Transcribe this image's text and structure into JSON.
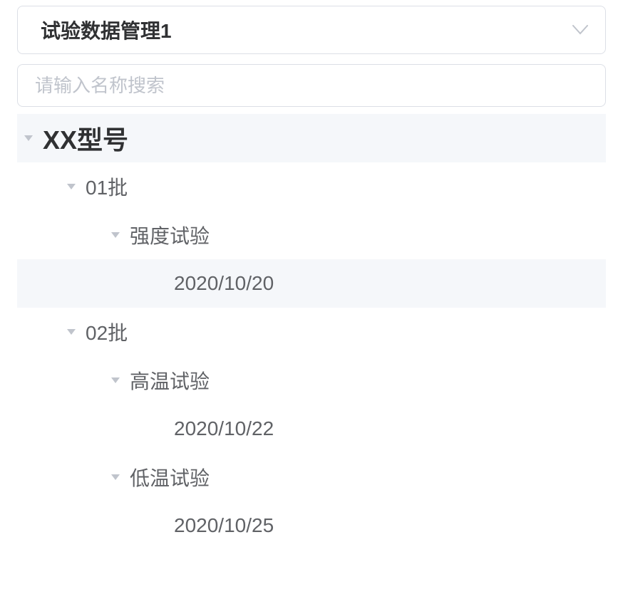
{
  "select": {
    "value": "试验数据管理1"
  },
  "search": {
    "placeholder": "请输入名称搜索"
  },
  "tree": {
    "root": {
      "label": "XX型号",
      "children": [
        {
          "label": "01批",
          "children": [
            {
              "label": "强度试验",
              "children": [
                {
                  "label": "2020/10/20"
                }
              ]
            }
          ]
        },
        {
          "label": "02批",
          "children": [
            {
              "label": "高温试验",
              "children": [
                {
                  "label": "2020/10/22"
                }
              ]
            },
            {
              "label": "低温试验",
              "children": [
                {
                  "label": "2020/10/25"
                }
              ]
            }
          ]
        }
      ]
    }
  }
}
